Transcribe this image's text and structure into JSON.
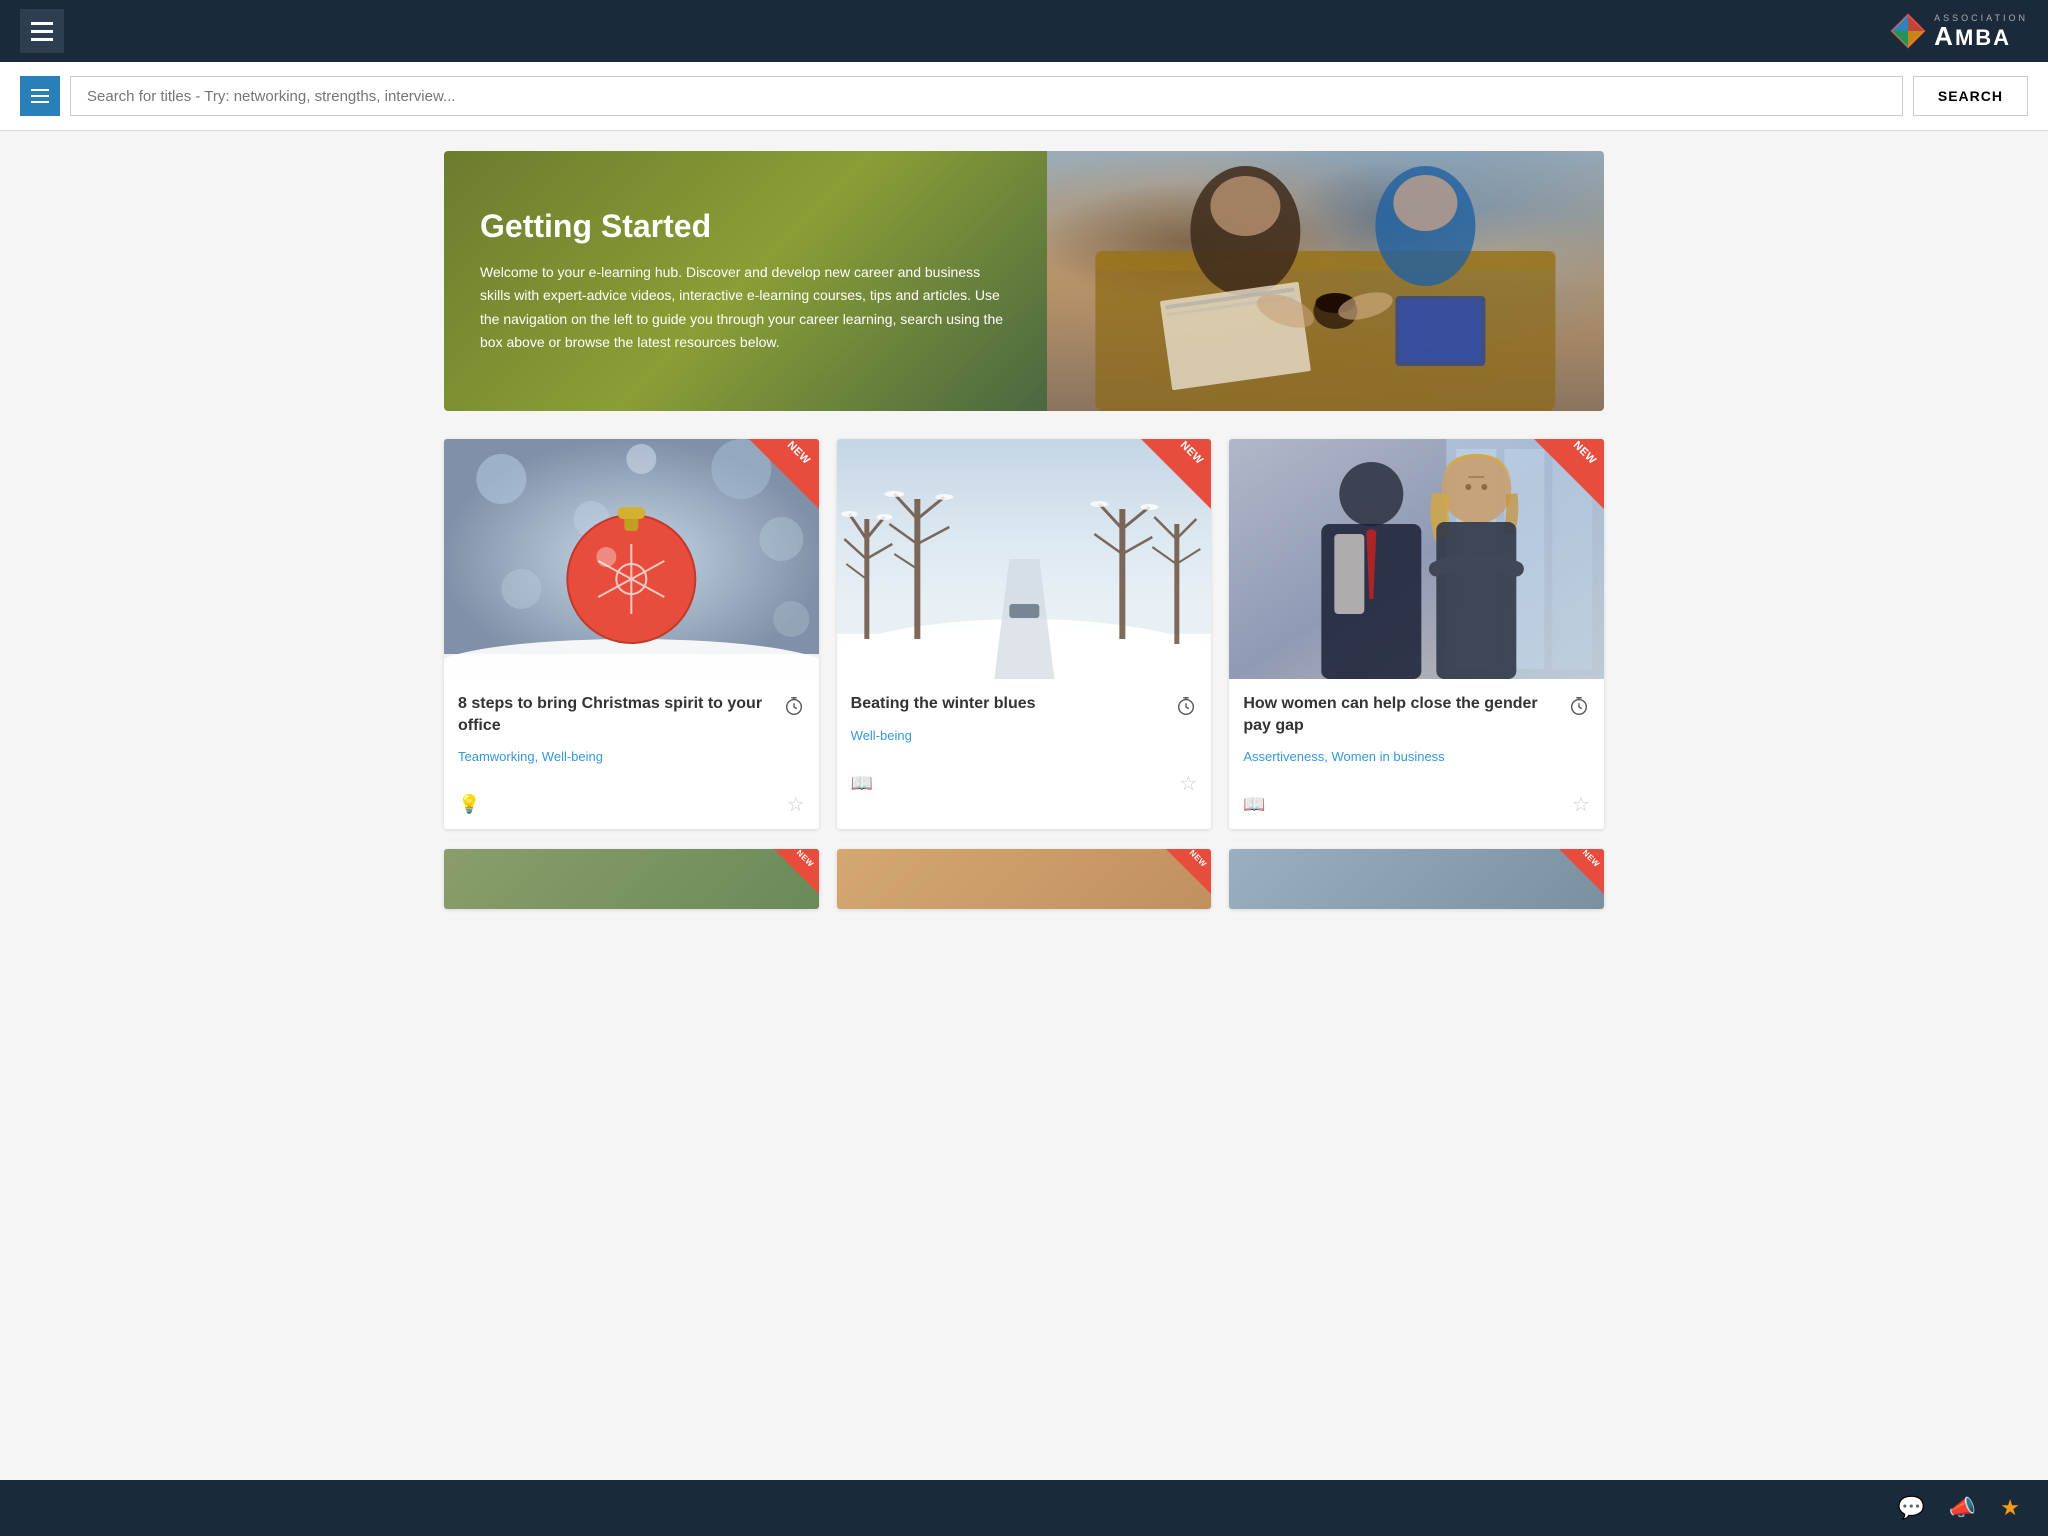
{
  "topNav": {
    "hamburger_label": "Menu",
    "logo_text": "AMBA",
    "logo_subtext": "ASSOCIATION"
  },
  "searchBar": {
    "placeholder": "Search for titles - Try: networking, strengths, interview...",
    "button_label": "SEARCH"
  },
  "hero": {
    "title": "Getting Started",
    "description": "Welcome to your e-learning hub. Discover and develop new career and business skills with expert-advice videos, interactive e-learning courses, tips and articles. Use the navigation on the left to guide you through your career learning, search using the box above or browse the latest resources below."
  },
  "cards": [
    {
      "title": "8 steps to bring Christmas spirit to your office",
      "tags": "Teamworking, Well-being",
      "badge": "NEW",
      "icon_type": "lightbulb",
      "img_type": "christmas"
    },
    {
      "title": "Beating the winter blues",
      "tags": "Well-being",
      "badge": "NEW",
      "icon_type": "book",
      "img_type": "winter"
    },
    {
      "title": "How women can help close the gender pay gap",
      "tags": "Assertiveness, Women in business",
      "badge": "NEW",
      "icon_type": "book",
      "img_type": "women"
    }
  ],
  "bottomNav": {
    "chat_icon": "💬",
    "announce_icon": "📣",
    "star_icon": "★"
  }
}
